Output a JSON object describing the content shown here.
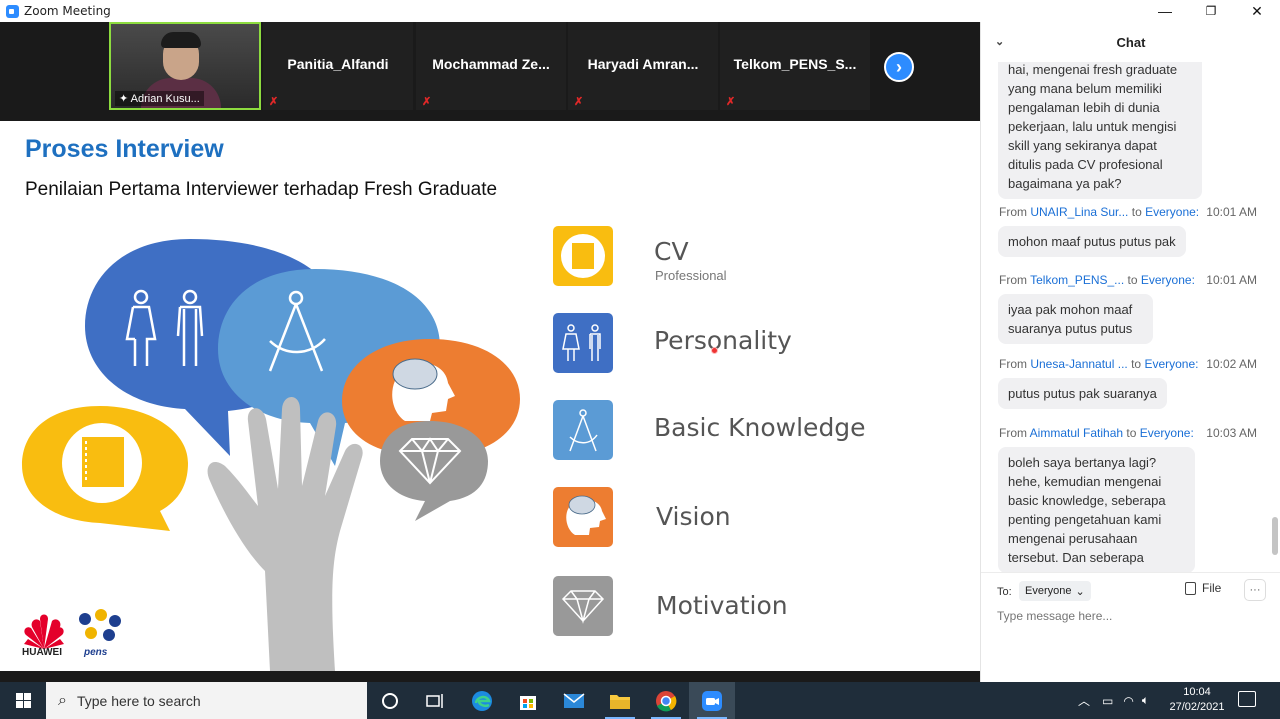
{
  "window": {
    "title": "Zoom Meeting",
    "controls": {
      "minimize": "—",
      "restore": "❐",
      "close": "✕"
    }
  },
  "participants": [
    {
      "name": "Adrian Kusu...",
      "video_on": true,
      "pinned": true
    },
    {
      "name": "Panitia_Alfandi",
      "muted": true
    },
    {
      "name": "Mochammad  Ze...",
      "muted": true
    },
    {
      "name": "Haryadi  Amran...",
      "muted": true
    },
    {
      "name": "Telkom_PENS_S...",
      "muted": true
    }
  ],
  "slide": {
    "title": "Proses Interview",
    "subtitle": "Penilaian Pertama Interviewer terhadap Fresh Graduate",
    "features": [
      {
        "label": "CV",
        "sublabel": "Professional",
        "color": "#f9bd10",
        "icon": "notebook-icon"
      },
      {
        "label": "Personality",
        "color": "#3f6fc4",
        "icon": "people-icon"
      },
      {
        "label": "Basic Knowledge",
        "color": "#5b9bd5",
        "icon": "compass-icon"
      },
      {
        "label": "Vision",
        "color": "#ed7d31",
        "icon": "brain-icon"
      },
      {
        "label": "Motivation",
        "color": "#999999",
        "icon": "diamond-icon"
      }
    ],
    "logos": {
      "huawei": "HUAWEI",
      "pens": "pens"
    }
  },
  "chat": {
    "title": "Chat",
    "messages": [
      {
        "text": "hai, mengenai fresh graduate yang mana belum memiliki pengalaman lebih di dunia pekerjaan, lalu untuk mengisi skill yang sekiranya dapat ditulis pada CV profesional bagaimana ya pak?"
      },
      {
        "from_label": "From",
        "sender": "UNAIR_Lina Sur...",
        "to_label": "to",
        "to": "Everyone:",
        "time": "10:01 AM",
        "text": "mohon maaf putus putus pak"
      },
      {
        "from_label": "From",
        "sender": "Telkom_PENS_...",
        "to_label": "to",
        "to": "Everyone:",
        "time": "10:01 AM",
        "text": "iyaa pak mohon maaf suaranya putus putus"
      },
      {
        "from_label": "From",
        "sender": "Unesa-Jannatul ...",
        "to_label": "to",
        "to": "Everyone:",
        "time": "10:02 AM",
        "text": "putus putus pak suaranya"
      },
      {
        "from_label": "From",
        "sender": "Aimmatul Fatihah",
        "to_label": "to",
        "to": "Everyone:",
        "time": "10:03 AM",
        "text": "boleh saya bertanya lagi? hehe, kemudian mengenai basic knowledge, seberapa penting pengetahuan kami mengenai perusahaan tersebut. Dan seberapa"
      }
    ],
    "compose": {
      "to_label": "To:",
      "recipient": "Everyone",
      "file_label": "File",
      "more": "···",
      "placeholder": "Type message here..."
    }
  },
  "taskbar": {
    "search_placeholder": "Type here to search",
    "time": "10:04",
    "date": "27/02/2021"
  }
}
